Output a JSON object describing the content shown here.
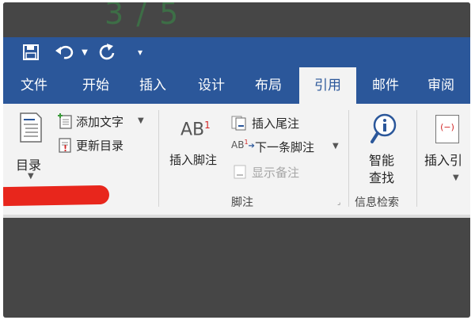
{
  "page_number": "3 / 5",
  "qat": {
    "save_icon": "save-icon",
    "undo_icon": "undo-icon",
    "redo_icon": "redo-icon",
    "customize_icon": "customize-qat-icon"
  },
  "tabs": [
    "文件",
    "开始",
    "插入",
    "设计",
    "布局",
    "引用",
    "邮件",
    "审阅"
  ],
  "active_tab": "引用",
  "ribbon": {
    "toc": {
      "label": "目录"
    },
    "add_text": {
      "label": "添加文字"
    },
    "update_toc": {
      "label": "更新目录"
    },
    "footnote": {
      "icon_text": "AB",
      "icon_sup": "1",
      "insert_footnote": "插入脚注",
      "insert_endnote": "插入尾注",
      "next_footnote": "下一条脚注",
      "next_icon_text": "AB",
      "next_icon_sup": "1",
      "show_notes": "显示备注",
      "group_label": "脚注"
    },
    "smart": {
      "line1": "智能",
      "line2": "查找",
      "group_label": "信息检索"
    },
    "citation": {
      "icon_text": "(−)",
      "label": "插入引"
    }
  },
  "colors": {
    "accent": "#2b579a",
    "ribbon_bg": "#f3f3f3",
    "redaction": "#e8261c",
    "backdrop": "#464646"
  }
}
